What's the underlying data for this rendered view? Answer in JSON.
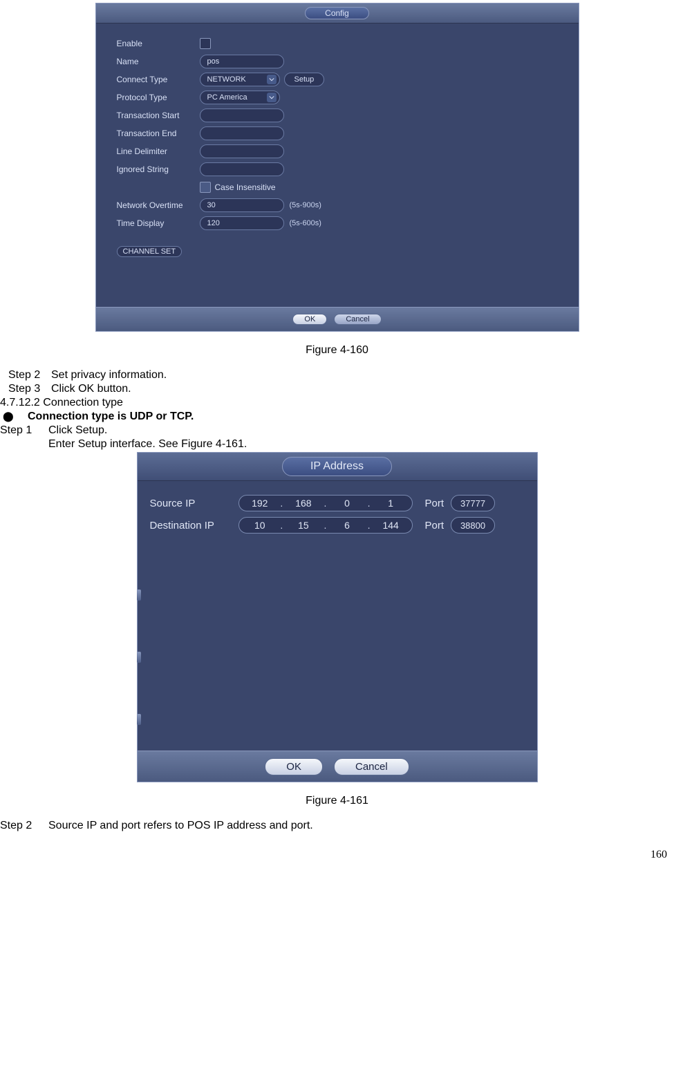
{
  "fig160": {
    "title": "Config",
    "rows": {
      "enable_label": "Enable",
      "name_label": "Name",
      "name_value": "pos",
      "connect_label": "Connect Type",
      "connect_value": "NETWORK",
      "setup_label": "Setup",
      "protocol_label": "Protocol Type",
      "protocol_value": "PC America",
      "trans_start_label": "Transaction Start",
      "trans_start_value": "",
      "trans_end_label": "Transaction End",
      "trans_end_value": "",
      "line_delim_label": "Line Delimiter",
      "line_delim_value": "",
      "ignored_label": "Ignored String",
      "ignored_value": "",
      "case_ins_label": "Case Insensitive",
      "net_ot_label": "Network Overtime",
      "net_ot_value": "30",
      "net_ot_hint": "(5s-900s)",
      "time_disp_label": "Time Display",
      "time_disp_value": "120",
      "time_disp_hint": "(5s-600s)",
      "channel_set": "CHANNEL SET"
    },
    "footer": {
      "ok": "OK",
      "cancel": "Cancel"
    },
    "caption": "Figure 4-160"
  },
  "doc": {
    "step2top": {
      "label": "Step 2",
      "text": "Set privacy information."
    },
    "step3top": {
      "label": "Step 3",
      "text": "Click OK button."
    },
    "subsection": "4.7.12.2  Connection type",
    "bullet1": "Connection type is UDP or TCP.",
    "step1mid": {
      "label": "Step 1",
      "text": "Click Setup."
    },
    "step1mid_cont": "Enter Setup interface. See Figure 4-161.",
    "step2bot": {
      "label": "Step 2",
      "text": "Source IP and port refers to POS IP address and port."
    }
  },
  "fig161": {
    "title": "IP Address",
    "row1": {
      "label": "Source IP",
      "ip": [
        "192",
        "168",
        "0",
        "1"
      ],
      "port_label": "Port",
      "port": "37777"
    },
    "row2": {
      "label": "Destination IP",
      "ip": [
        "10",
        "15",
        "6",
        "144"
      ],
      "port_label": "Port",
      "port": "38800"
    },
    "footer": {
      "ok": "OK",
      "cancel": "Cancel"
    },
    "caption": "Figure 4-161"
  },
  "page_number": "160"
}
